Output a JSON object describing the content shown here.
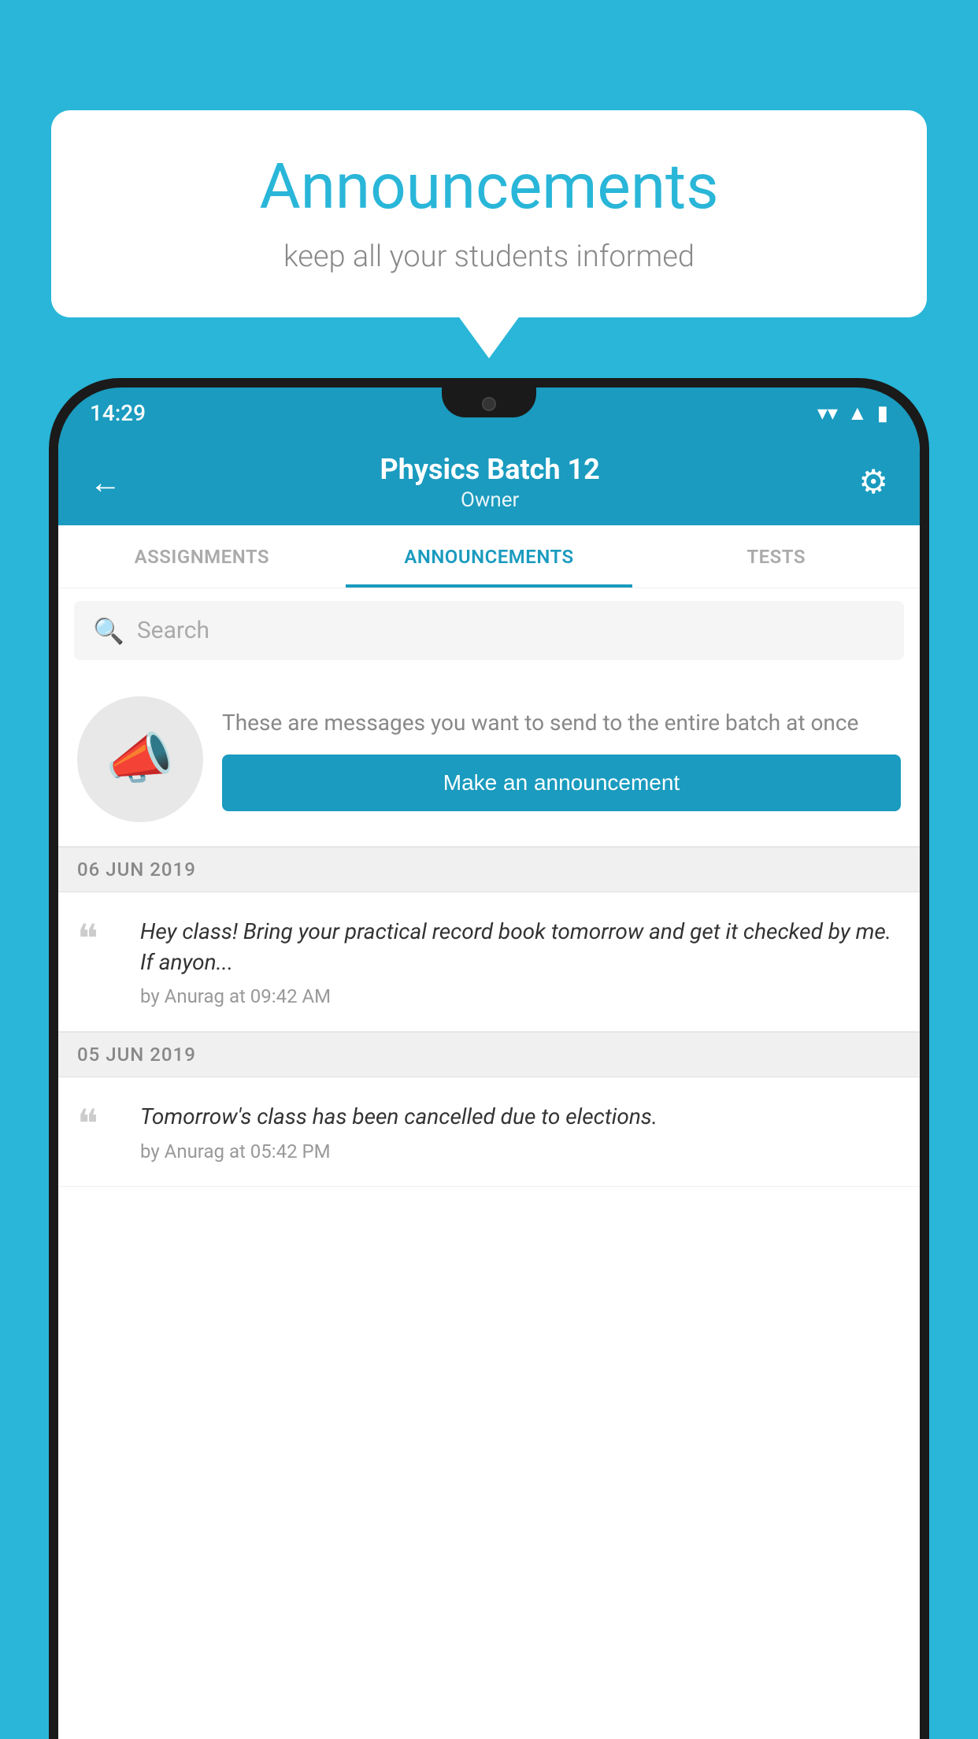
{
  "speech_bubble": {
    "title": "Announcements",
    "subtitle": "keep all your students informed"
  },
  "phone": {
    "status_bar": {
      "time": "14:29"
    },
    "app_bar": {
      "title": "Physics Batch 12",
      "subtitle": "Owner",
      "back_label": "←",
      "gear_label": "⚙"
    },
    "tabs": [
      {
        "label": "ASSIGNMENTS",
        "active": false
      },
      {
        "label": "ANNOUNCEMENTS",
        "active": true
      },
      {
        "label": "TESTS",
        "active": false
      },
      {
        "label": "...",
        "active": false
      }
    ],
    "search": {
      "placeholder": "Search"
    },
    "promo": {
      "description": "These are messages you want to send to the entire batch at once",
      "button_label": "Make an announcement"
    },
    "announcements": [
      {
        "date": "06  JUN  2019",
        "message": "Hey class! Bring your practical record book tomorrow and get it checked by me. If anyon...",
        "meta": "by Anurag at 09:42 AM"
      },
      {
        "date": "05  JUN  2019",
        "message": "Tomorrow's class has been cancelled due to elections.",
        "meta": "by Anurag at 05:42 PM"
      }
    ]
  }
}
